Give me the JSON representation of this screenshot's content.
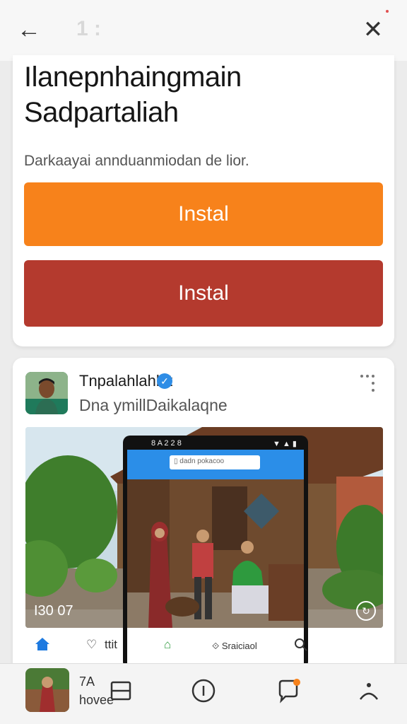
{
  "topbar": {
    "back_glyph": "←",
    "faint_text": "1 :",
    "close_glyph": "✕"
  },
  "promo": {
    "title_line1": "Ilanepnhaingmain",
    "title_line2": "Sadpartaliah",
    "description": "Darkaayai annduanmiodan de lior.",
    "button_primary": "Instal",
    "button_secondary": "Instal",
    "colors": {
      "primary": "#f7821b",
      "secondary": "#b43a2e"
    }
  },
  "post": {
    "username": "Tnpalahlahlat",
    "verified_glyph": "✓",
    "subtitle": "Dna ymillDaikalaqne",
    "photo_count": "I30 07",
    "play_glyph": "↻",
    "phone": {
      "status_left": "8 A 2 2 8",
      "status_right": "▼ ▲ ▮",
      "url_text": "▯ dadn pokacoo",
      "foot_text": "⟐ Sraiciaol"
    },
    "actions": {
      "second": "ttit",
      "third": "⌂"
    }
  },
  "bottomnav": {
    "text_line1": "7A",
    "text_line2": "hovee",
    "badge_color": "#f7821b"
  }
}
